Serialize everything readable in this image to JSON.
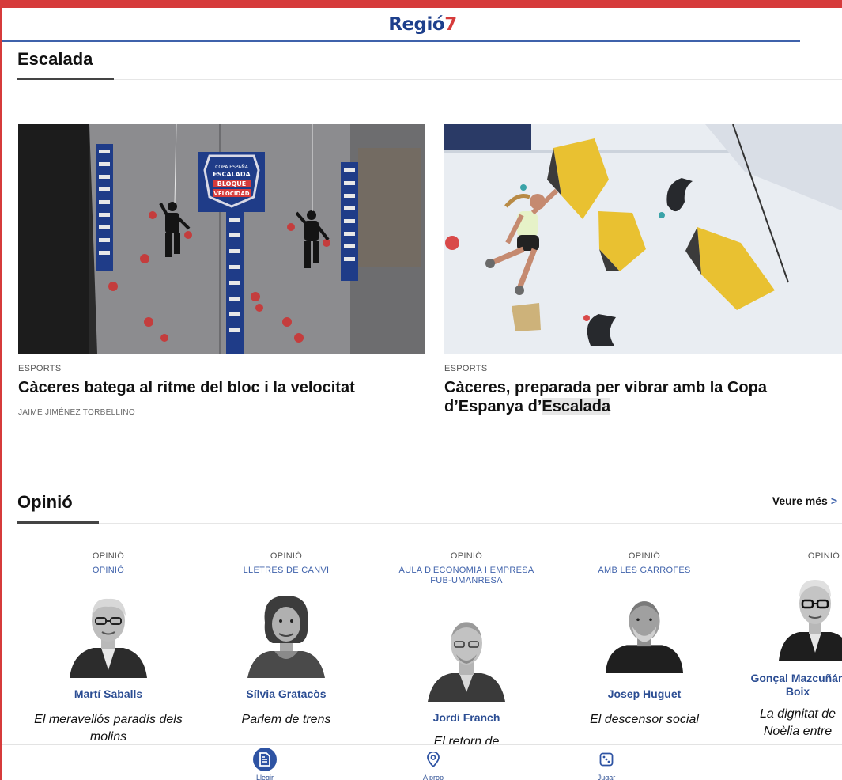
{
  "header": {
    "brand_part1": "Regió",
    "brand_part2": "7"
  },
  "climbing_section": {
    "title": "Escalada",
    "articles": [
      {
        "kicker": "ESPORTS",
        "headline": "Càceres batega al ritme del bloc i la velocitat",
        "author": "JAIME JIMÉNEZ TORBELLINO",
        "banner_lines": [
          "COPA ESPAÑA",
          "ESCALADA",
          "BLOQUE",
          "VELOCIDAD"
        ]
      },
      {
        "kicker": "ESPORTS",
        "headline_main": "Càceres, preparada per vibrar amb la Copa d’Espanya d’",
        "headline_highlight": "Escalada"
      }
    ]
  },
  "opinion_section": {
    "title": "Opinió",
    "more_label": "Veure més",
    "more_icon": "chevron-right-icon",
    "columnists": [
      {
        "label": "OPINIÓ",
        "section": "OPINIÓ",
        "name": "Martí Saballs",
        "title": "El meravellós paradís dels molins"
      },
      {
        "label": "OPINIÓ",
        "section": "LLETRES DE CANVI",
        "name": "Sílvia Gratacòs",
        "title": "Parlem de trens"
      },
      {
        "label": "OPINIÓ",
        "section": "AULA D'ECONOMIA I EMPRESA FUB-UMANRESA",
        "name": "Jordi Franch",
        "title": "El retorn de"
      },
      {
        "label": "OPINIÓ",
        "section": "AMB LES GARROFES",
        "name": "Josep Huguet",
        "title": "El descensor social"
      },
      {
        "label": "OPINIÓ",
        "section": "",
        "name": "Gonçal Mazcuñán Boix",
        "title": "La dignitat de Noèlia entre"
      }
    ]
  },
  "bottom_nav": {
    "items": [
      {
        "label": "Llegir",
        "icon": "document-icon",
        "active": true
      },
      {
        "label": "A prop",
        "icon": "location-pin-icon",
        "active": false
      },
      {
        "label": "Jugar",
        "icon": "dice-icon",
        "active": false
      }
    ]
  },
  "colors": {
    "brand_blue": "#1d3f8c",
    "brand_red": "#d63b3b",
    "accent_blue": "#2e53a3"
  }
}
